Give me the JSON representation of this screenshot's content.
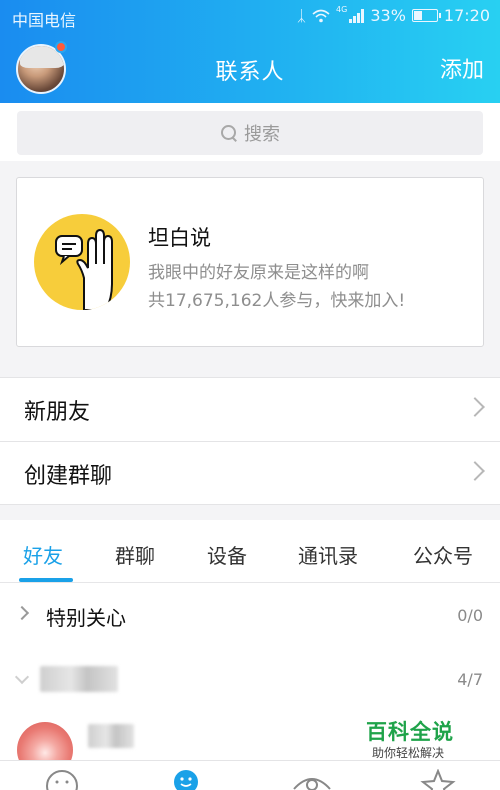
{
  "status_bar": {
    "carrier": "中国电信",
    "network": "4G",
    "battery": "33%",
    "time": "17:20",
    "battery_level": 0.33
  },
  "header": {
    "title": "联系人",
    "add_label": "添加"
  },
  "search": {
    "placeholder": "搜索"
  },
  "banner": {
    "title": "坦白说",
    "subtitle": "我眼中的好友原来是这样的啊",
    "participants": "共17,675,162人参与，快来加入!"
  },
  "menu": {
    "new_friends": "新朋友",
    "create_group_chat": "创建群聊"
  },
  "tabs": [
    {
      "label": "好友",
      "active": true
    },
    {
      "label": "群聊",
      "active": false
    },
    {
      "label": "设备",
      "active": false
    },
    {
      "label": "通讯录",
      "active": false
    },
    {
      "label": "公众号",
      "active": false
    }
  ],
  "groups": [
    {
      "name": "特别关心",
      "count": "0/0"
    },
    {
      "name": "",
      "count": "4/7"
    }
  ],
  "watermark": {
    "main": "百科全说",
    "sub": "助你轻松解决"
  },
  "colors": {
    "accent": "#1aa1e8",
    "header_start": "#1a8cf0",
    "header_end": "#28d0f2",
    "watermark_green": "#1fa34a",
    "banner_icon_yellow": "#f7cd3b"
  },
  "icons": {
    "search": "magnifier-icon",
    "chevron": "chevron-right-icon",
    "nav": [
      "smiley-icon",
      "contacts-icon",
      "eye-icon",
      "star-icon"
    ]
  }
}
